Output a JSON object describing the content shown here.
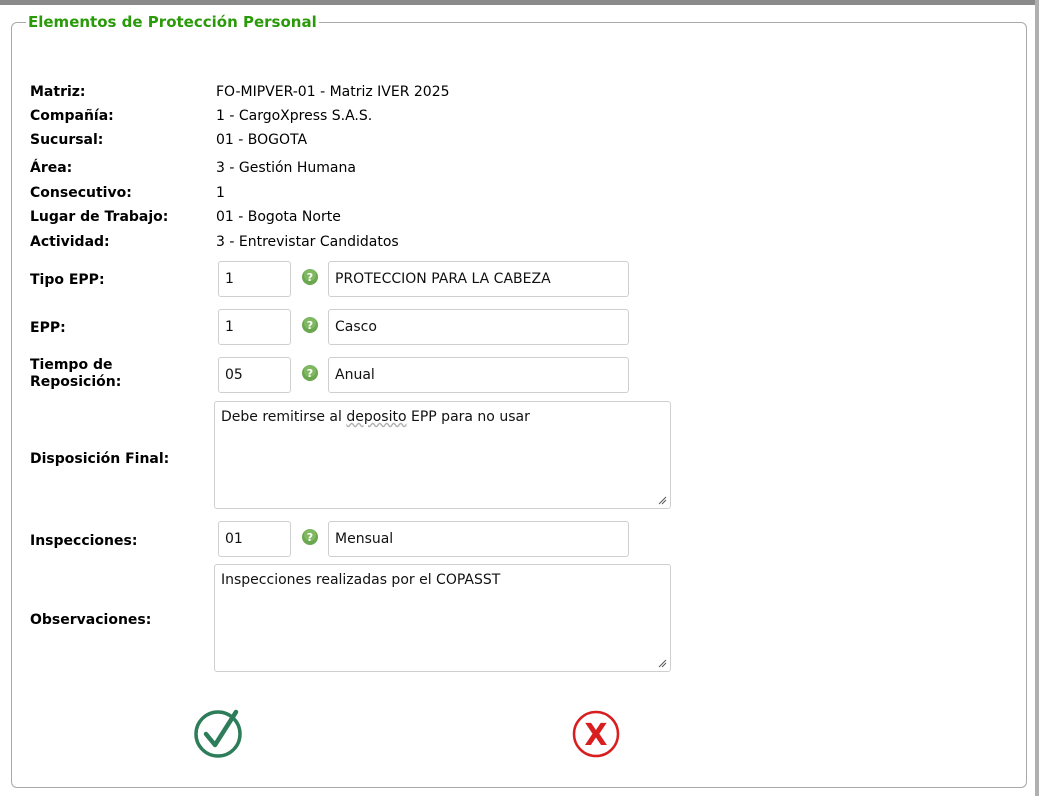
{
  "panel": {
    "title": "Elementos de Protección Personal"
  },
  "info": [
    {
      "label": "Matriz:",
      "value": "FO-MIPVER-01 - Matriz IVER 2025"
    },
    {
      "label": "Compañía:",
      "value": "1 - CargoXpress S.A.S."
    },
    {
      "label": "Sucursal:",
      "value": "01 - BOGOTA"
    },
    {
      "label": "Área:",
      "value": "3 - Gestión Humana"
    },
    {
      "label": "Consecutivo:",
      "value": "1"
    },
    {
      "label": "Lugar de Trabajo:",
      "value": "01 - Bogota Norte"
    },
    {
      "label": "Actividad:",
      "value": "3 - Entrevistar Candidatos"
    }
  ],
  "fields": {
    "tipo_epp": {
      "label": "Tipo EPP:",
      "code": "1",
      "description": "PROTECCION PARA LA CABEZA"
    },
    "epp": {
      "label": "EPP:",
      "code": "1",
      "description": "Casco"
    },
    "tiempo_reposicion": {
      "label_line1": "Tiempo de",
      "label_line2": "Reposición:",
      "code": "05",
      "description": "Anual"
    },
    "disposicion_final": {
      "label": "Disposición Final:",
      "text_before": "Debe remitirse al ",
      "text_squiggle": "deposito",
      "text_after": " EPP para no usar"
    },
    "inspecciones": {
      "label": "Inspecciones:",
      "code": "01",
      "description": "Mensual"
    },
    "observaciones": {
      "label": "Observaciones:",
      "text": "Inspecciones realizadas por el COPASST"
    }
  },
  "icons": {
    "help": "question-circle-icon",
    "accept": "check-circle-icon",
    "cancel": "x-circle-icon"
  },
  "colors": {
    "title": "#2a9a0a",
    "accept": "#2e7d5a",
    "cancel": "#d81e1e",
    "help": "#6aa84f"
  }
}
